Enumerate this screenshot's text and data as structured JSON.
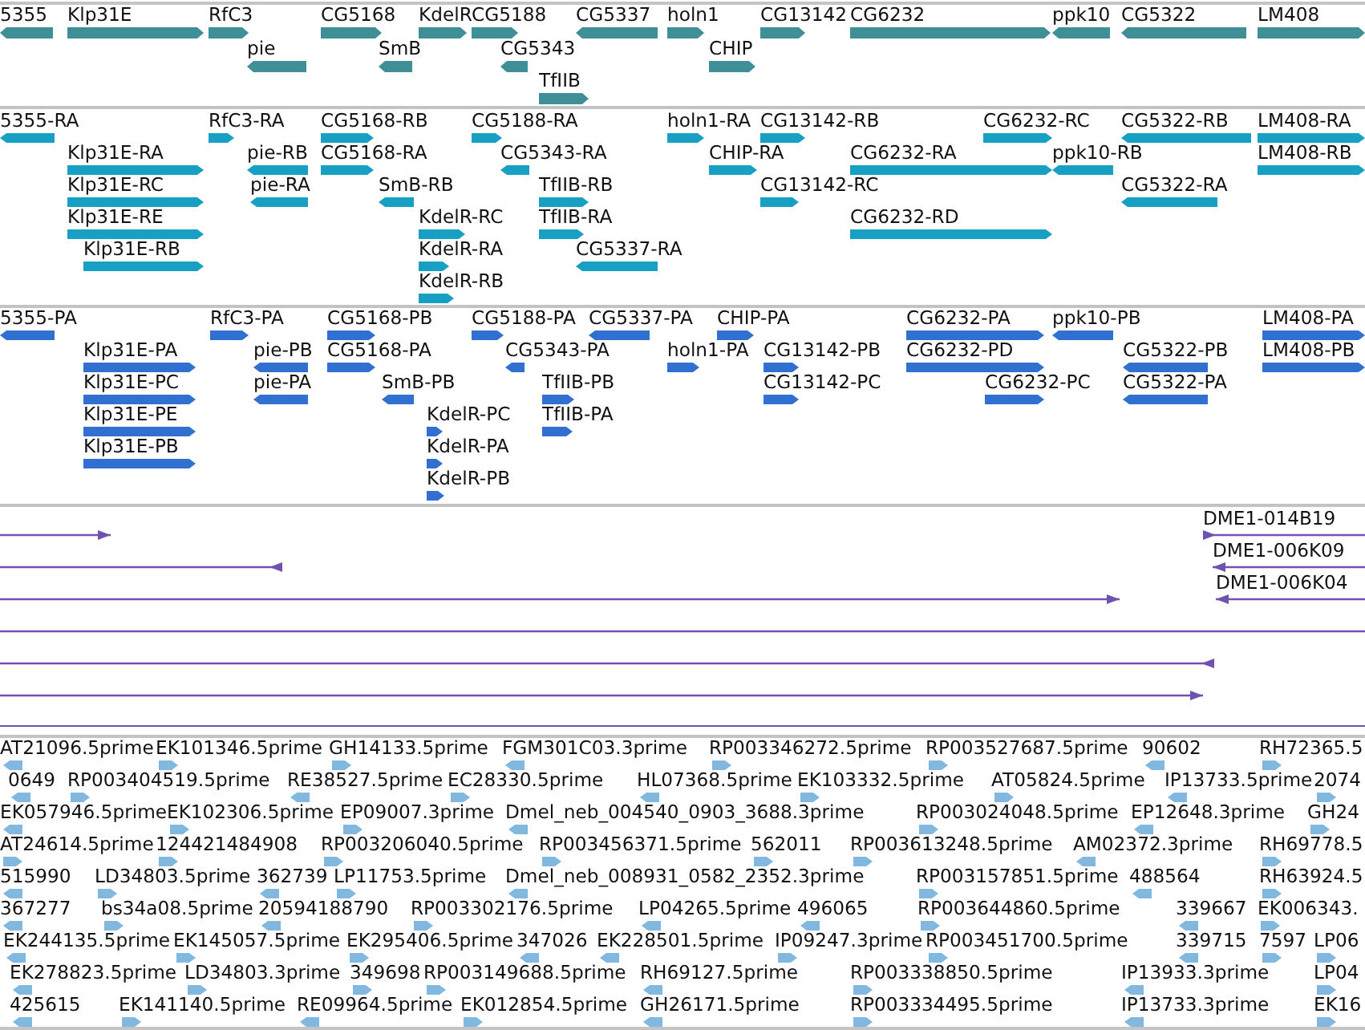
{
  "tracks": [
    {
      "kind": "gene",
      "features": [
        {
          "label": "5355",
          "reverse": true
        },
        {
          "label": "Klp31E",
          "reverse": false
        },
        {
          "label": "RfC3",
          "reverse": false
        },
        {
          "label": "CG5168",
          "reverse": false
        },
        {
          "label": "KdelR",
          "reverse": false
        },
        {
          "label": "CG5188",
          "reverse": false
        },
        {
          "label": "CG5337",
          "reverse": true
        },
        {
          "label": "holn1",
          "reverse": false
        },
        {
          "label": "CG13142",
          "reverse": false
        },
        {
          "label": "CG6232",
          "reverse": false
        },
        {
          "label": "ppk10",
          "reverse": true
        },
        {
          "label": "CG5322",
          "reverse": true
        },
        {
          "label": "LM408",
          "reverse": false
        },
        {
          "label": "pie",
          "reverse": true
        },
        {
          "label": "SmB",
          "reverse": true
        },
        {
          "label": "CG5343",
          "reverse": true
        },
        {
          "label": "CHIP",
          "reverse": false
        },
        {
          "label": "TfIIB",
          "reverse": false
        }
      ]
    },
    {
      "kind": "transcript",
      "features": [
        {
          "label": "5355-RA",
          "reverse": true
        },
        {
          "label": "RfC3-RA",
          "reverse": false
        },
        {
          "label": "CG5168-RB",
          "reverse": false
        },
        {
          "label": "CG5188-RA",
          "reverse": false
        },
        {
          "label": "holn1-RA",
          "reverse": false
        },
        {
          "label": "CG13142-RB",
          "reverse": false
        },
        {
          "label": "CG6232-RC",
          "reverse": false
        },
        {
          "label": "CG5322-RB",
          "reverse": true
        },
        {
          "label": "LM408-RA",
          "reverse": false
        },
        {
          "label": "Klp31E-RA",
          "reverse": false
        },
        {
          "label": "pie-RB",
          "reverse": true
        },
        {
          "label": "CG5168-RA",
          "reverse": false
        },
        {
          "label": "CG5343-RA",
          "reverse": true
        },
        {
          "label": "CHIP-RA",
          "reverse": false
        },
        {
          "label": "CG6232-RA",
          "reverse": false
        },
        {
          "label": "ppk10-RB",
          "reverse": true
        },
        {
          "label": "LM408-RB",
          "reverse": false
        },
        {
          "label": "Klp31E-RC",
          "reverse": false
        },
        {
          "label": "pie-RA",
          "reverse": true
        },
        {
          "label": "SmB-RB",
          "reverse": true
        },
        {
          "label": "TfIIB-RB",
          "reverse": false
        },
        {
          "label": "CG13142-RC",
          "reverse": false
        },
        {
          "label": "CG5322-RA",
          "reverse": true
        },
        {
          "label": "Klp31E-RE",
          "reverse": false
        },
        {
          "label": "KdelR-RC",
          "reverse": false
        },
        {
          "label": "TfIIB-RA",
          "reverse": false
        },
        {
          "label": "CG6232-RD",
          "reverse": false
        },
        {
          "label": "Klp31E-RB",
          "reverse": false
        },
        {
          "label": "KdelR-RA",
          "reverse": false
        },
        {
          "label": "CG5337-RA",
          "reverse": true
        },
        {
          "label": "KdelR-RB",
          "reverse": false
        }
      ]
    },
    {
      "kind": "protein",
      "features": [
        {
          "label": "5355-PA",
          "reverse": true
        },
        {
          "label": "RfC3-PA",
          "reverse": false
        },
        {
          "label": "CG5168-PB",
          "reverse": false
        },
        {
          "label": "CG5188-PA",
          "reverse": false
        },
        {
          "label": "CG5337-PA",
          "reverse": true
        },
        {
          "label": "CHIP-PA",
          "reverse": false
        },
        {
          "label": "CG6232-PA",
          "reverse": false
        },
        {
          "label": "ppk10-PB",
          "reverse": true
        },
        {
          "label": "LM408-PA",
          "reverse": false
        },
        {
          "label": "Klp31E-PA",
          "reverse": false
        },
        {
          "label": "pie-PB",
          "reverse": true
        },
        {
          "label": "CG5168-PA",
          "reverse": false
        },
        {
          "label": "CG5343-PA",
          "reverse": true
        },
        {
          "label": "holn1-PA",
          "reverse": false
        },
        {
          "label": "CG13142-PB",
          "reverse": false
        },
        {
          "label": "CG6232-PD",
          "reverse": false
        },
        {
          "label": "CG5322-PB",
          "reverse": true
        },
        {
          "label": "LM408-PB",
          "reverse": false
        },
        {
          "label": "Klp31E-PC",
          "reverse": false
        },
        {
          "label": "pie-PA",
          "reverse": true
        },
        {
          "label": "SmB-PB",
          "reverse": true
        },
        {
          "label": "TfIIB-PB",
          "reverse": false
        },
        {
          "label": "CG13142-PC",
          "reverse": false
        },
        {
          "label": "CG6232-PC",
          "reverse": false
        },
        {
          "label": "CG5322-PA",
          "reverse": true
        },
        {
          "label": "Klp31E-PE",
          "reverse": false
        },
        {
          "label": "KdelR-PC",
          "reverse": false
        },
        {
          "label": "TfIIB-PA",
          "reverse": false
        },
        {
          "label": "Klp31E-PB",
          "reverse": false
        },
        {
          "label": "KdelR-PA",
          "reverse": false
        },
        {
          "label": "KdelR-PB",
          "reverse": false
        }
      ]
    },
    {
      "kind": "clone",
      "features": [
        {
          "kind": "arrow",
          "reverse": false
        },
        {
          "kind": "arrow",
          "label": "DME1-014B19",
          "reverse": false
        },
        {
          "kind": "arrow",
          "reverse": true
        },
        {
          "kind": "arrow",
          "label": "DME1-006K09",
          "reverse": true
        },
        {
          "kind": "arrow",
          "reverse": false
        },
        {
          "kind": "arrow",
          "label": "DME1-006K04",
          "reverse": true
        },
        {
          "kind": "line"
        },
        {
          "kind": "arrow",
          "reverse": true
        },
        {
          "kind": "arrow",
          "reverse": false
        }
      ]
    },
    {
      "kind": "est",
      "features": [
        {
          "label": "AT21096.5prime",
          "reverse": true
        },
        {
          "label": "EK101346.5prime",
          "reverse": false
        },
        {
          "label": "GH14133.5prime",
          "reverse": false
        },
        {
          "label": "FGM301C03.3prime",
          "reverse": true
        },
        {
          "label": "RP003346272.5prime",
          "reverse": false
        },
        {
          "label": "RP003527687.5prime",
          "reverse": false
        },
        {
          "label": "90602",
          "reverse": true
        },
        {
          "label": "RH72365.5",
          "reverse": false
        },
        {
          "label": "0649",
          "reverse": true
        },
        {
          "label": "RP003404519.5prime",
          "reverse": false
        },
        {
          "label": "RE38527.5prime",
          "reverse": true
        },
        {
          "label": "EC28330.5prime",
          "reverse": false
        },
        {
          "label": "HL07368.5prime",
          "reverse": true
        },
        {
          "label": "EK103332.5prime",
          "reverse": false
        },
        {
          "label": "AT05824.5prime",
          "reverse": false
        },
        {
          "label": "IP13733.5prime",
          "reverse": true
        },
        {
          "label": "2074",
          "reverse": false
        },
        {
          "label": "EK057946.5prime",
          "reverse": true
        },
        {
          "label": "EK102306.5prime",
          "reverse": false
        },
        {
          "label": "EP09007.3prime",
          "reverse": false
        },
        {
          "label": "Dmel_neb_004540_0903_3688.3prime",
          "reverse": true
        },
        {
          "label": "RP003024048.5prime",
          "reverse": false
        },
        {
          "label": "EP12648.3prime",
          "reverse": true
        },
        {
          "label": "GH24",
          "reverse": false
        },
        {
          "label": "AT24614.5prime",
          "reverse": false
        },
        {
          "label": "124421484908",
          "reverse": false
        },
        {
          "label": "RP003206040.5prime",
          "reverse": false
        },
        {
          "label": "RP003456371.5prime",
          "reverse": false
        },
        {
          "label": "562011",
          "reverse": false
        },
        {
          "label": "RP003613248.5prime",
          "reverse": false
        },
        {
          "label": "AM02372.3prime",
          "reverse": true
        },
        {
          "label": "RH69778.5",
          "reverse": false
        },
        {
          "label": "515990",
          "reverse": true
        },
        {
          "label": "LD34803.5prime",
          "reverse": false
        },
        {
          "label": "362739",
          "reverse": true
        },
        {
          "label": "LP11753.5prime",
          "reverse": false
        },
        {
          "label": "Dmel_neb_008931_0582_2352.3prime",
          "reverse": true
        },
        {
          "label": "RP003157851.5prime",
          "reverse": false
        },
        {
          "label": "488564",
          "reverse": true
        },
        {
          "label": "RH63924.5",
          "reverse": false
        },
        {
          "label": "367277",
          "reverse": true
        },
        {
          "label": "bs34a08.5prime",
          "reverse": false
        },
        {
          "label": "20594188790",
          "reverse": true
        },
        {
          "label": "RP003302176.5prime",
          "reverse": false
        },
        {
          "label": "LP04265.5prime",
          "reverse": true
        },
        {
          "label": "496065",
          "reverse": true
        },
        {
          "label": "RP003644860.5prime",
          "reverse": false
        },
        {
          "label": "339667",
          "reverse": true
        },
        {
          "label": "EK006343.",
          "reverse": false
        },
        {
          "label": "EK244135.5prime",
          "reverse": true
        },
        {
          "label": "EK145057.5prime",
          "reverse": false
        },
        {
          "label": "EK295406.5prime",
          "reverse": false
        },
        {
          "label": "347026",
          "reverse": true
        },
        {
          "label": "EK228501.5prime",
          "reverse": true
        },
        {
          "label": "IP09247.3prime",
          "reverse": false
        },
        {
          "label": "RP003451700.5prime",
          "reverse": false
        },
        {
          "label": "339715",
          "reverse": true
        },
        {
          "label": "7597",
          "reverse": false
        },
        {
          "label": "LP06",
          "reverse": false
        },
        {
          "label": "EK278823.5prime",
          "reverse": true
        },
        {
          "label": "LD34803.3prime",
          "reverse": false
        },
        {
          "label": "349698",
          "reverse": false
        },
        {
          "label": "RP003149688.5prime",
          "reverse": false
        },
        {
          "label": "RH69127.5prime",
          "reverse": true
        },
        {
          "label": "RP003338850.5prime",
          "reverse": false
        },
        {
          "label": "IP13933.3prime",
          "reverse": true
        },
        {
          "label": "LP04",
          "reverse": false
        },
        {
          "label": "425615",
          "reverse": true
        },
        {
          "label": "EK141140.5prime",
          "reverse": false
        },
        {
          "label": "RE09964.5prime",
          "reverse": true
        },
        {
          "label": "EK012854.5prime",
          "reverse": false
        },
        {
          "label": "GH26171.5prime",
          "reverse": true
        },
        {
          "label": "RP003334495.5prime",
          "reverse": false
        },
        {
          "label": "IP13733.3prime",
          "reverse": true
        },
        {
          "label": "EK16",
          "reverse": false
        }
      ]
    }
  ]
}
